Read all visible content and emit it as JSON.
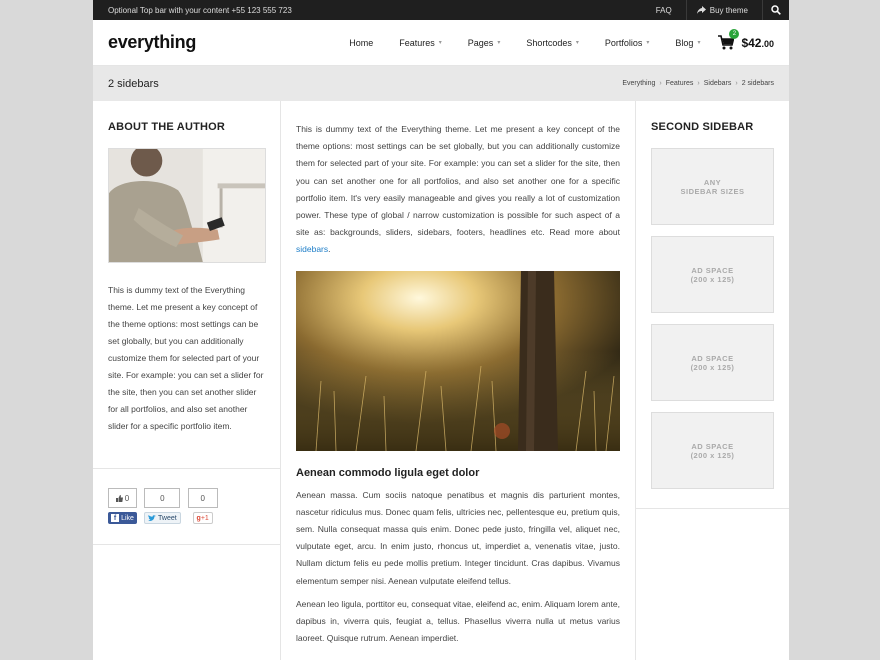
{
  "topbar": {
    "message": "Optional Top bar with your content +55 123 555 723",
    "faq": "FAQ",
    "buy_theme": "Buy theme"
  },
  "header": {
    "logo": "everything",
    "nav": [
      {
        "label": "Home",
        "has_dropdown": false
      },
      {
        "label": "Features",
        "has_dropdown": true
      },
      {
        "label": "Pages",
        "has_dropdown": true
      },
      {
        "label": "Shortcodes",
        "has_dropdown": true
      },
      {
        "label": "Portfolios",
        "has_dropdown": true
      },
      {
        "label": "Blog",
        "has_dropdown": true
      }
    ],
    "cart_count": "2",
    "cart_total": "$42",
    "cart_cents": ".00"
  },
  "titlebar": {
    "title": "2 sidebars",
    "breadcrumb": [
      "Everything",
      "Features",
      "Sidebars",
      "2 sidebars"
    ]
  },
  "left_sidebar": {
    "title": "ABOUT THE AUTHOR",
    "text": "This is dummy text of the Everything theme. Let me present a key concept of the theme options: most settings can be set globally, but you can additionally customize them for selected part of your site. For example: you can set a slider for the site, then you can set another slider for all portfolios, and also set another slider for a specific portfolio item.",
    "social": {
      "fb_count": "0",
      "fb_label": "Like",
      "tw_count": "0",
      "tw_label": "Tweet",
      "gp_count": "0",
      "gp_label": "+1"
    }
  },
  "main": {
    "intro": "This is dummy text of the Everything theme. Let me present a key concept of the theme options: most settings can be set globally, but you can additionally customize them for selected part of your site. For example: you can set a slider for the site, then you can set another one for all portfolios, and also set another one for a specific portfolio item. It's very easily manageable and gives you really a lot of customization power. These type of global / narrow customization is possible for such aspect of a site as: backgrounds, sliders, sidebars, footers, headlines etc. Read more about ",
    "intro_link": "sidebars",
    "intro_end": ".",
    "subtitle": "Aenean commodo ligula eget dolor",
    "para1": "Aenean massa. Cum sociis natoque penatibus et magnis dis parturient montes, nascetur ridiculus mus. Donec quam felis, ultricies nec, pellentesque eu, pretium quis, sem. Nulla consequat massa quis enim. Donec pede justo, fringilla vel, aliquet nec, vulputate eget, arcu. In enim justo, rhoncus ut, imperdiet a, venenatis vitae, justo. Nullam dictum felis eu pede mollis pretium. Integer tincidunt. Cras dapibus. Vivamus elementum semper nisi. Aenean vulputate eleifend tellus.",
    "para2": "Aenean leo ligula, porttitor eu, consequat vitae, eleifend ac, enim. Aliquam lorem ante, dapibus in, viverra quis, feugiat a, tellus. Phasellus viverra nulla ut metus varius laoreet. Quisque rutrum. Aenean imperdiet."
  },
  "right_sidebar": {
    "title": "SECOND SIDEBAR",
    "ads": [
      {
        "line1": "ANY",
        "line2": "SIDEBAR SIZES"
      },
      {
        "line1": "AD SPACE",
        "line2": "(200 x 125)"
      },
      {
        "line1": "AD SPACE",
        "line2": "(200 x 125)"
      },
      {
        "line1": "AD SPACE",
        "line2": "(200 x 125)"
      }
    ]
  }
}
